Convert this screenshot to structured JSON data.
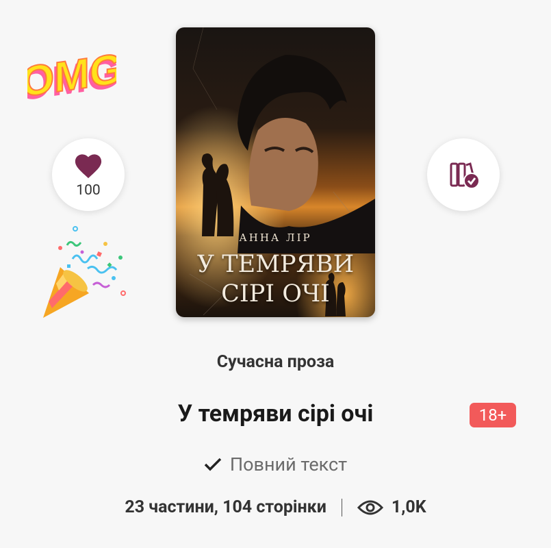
{
  "stickers": {
    "omg_text": "OMG"
  },
  "like": {
    "count": "100"
  },
  "cover": {
    "author": "АННА ЛІР",
    "title_line1": "У ТЕМРЯВИ",
    "title_line2": "СІРІ ОЧІ"
  },
  "book": {
    "genre": "Сучасна проза",
    "title": "У темряви сірі очі",
    "age_rating": "18+",
    "status": "Повний текст",
    "parts_pages": "23 частини, 104 сторінки",
    "views": "1,0K"
  },
  "colors": {
    "accent": "#7a2a52",
    "badge": "#f25a5a"
  }
}
